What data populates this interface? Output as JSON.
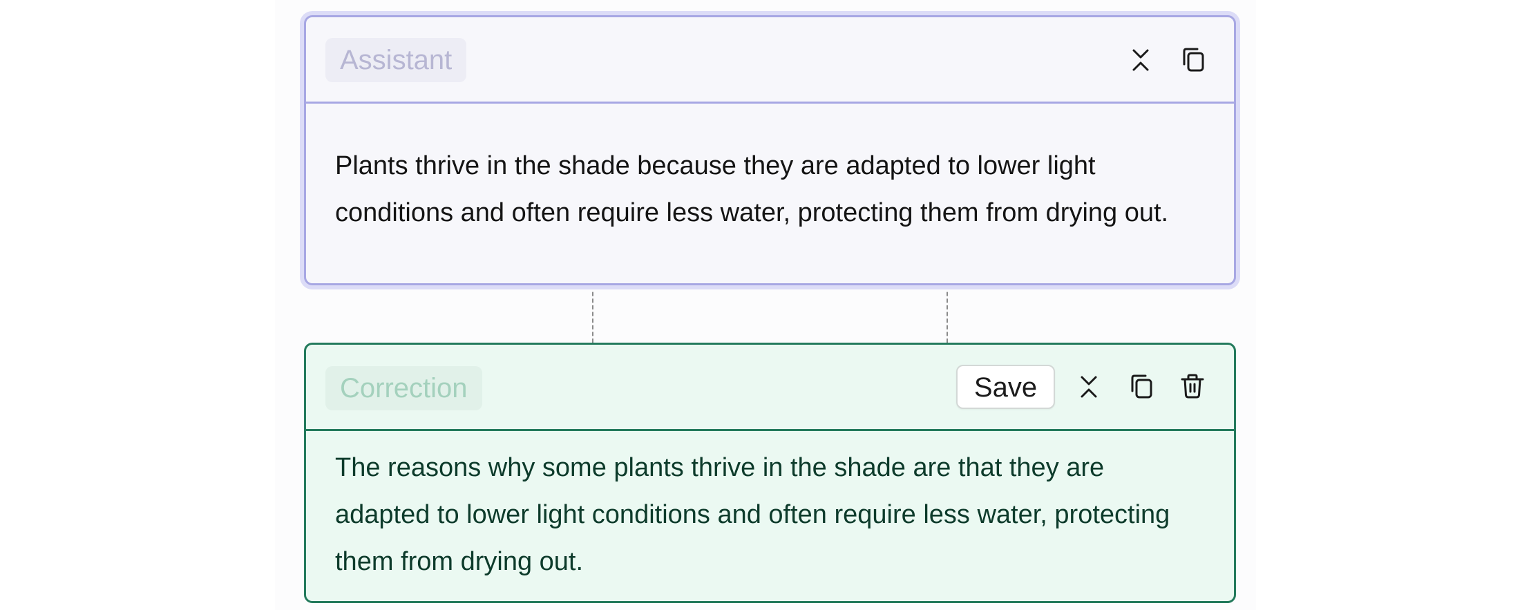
{
  "assistant": {
    "role_label": "Assistant",
    "text": "Plants thrive in the shade because they are adapted to lower light conditions and often require less water, protecting them from drying out.",
    "icons": {
      "collapse": "collapse-icon",
      "copy": "copy-icon"
    }
  },
  "correction": {
    "role_label": "Correction",
    "save_label": "Save",
    "text": "The reasons why some plants thrive in the shade are that they are adapted to lower light conditions and often require less water, protecting them from drying out.",
    "icons": {
      "collapse": "collapse-icon",
      "copy": "copy-icon",
      "delete": "trash-icon"
    }
  },
  "colors": {
    "assistant_border": "#a7a7e3",
    "assistant_background": "#f7f7fb",
    "correction_border": "#237a5c",
    "correction_background": "#ebf9f2"
  }
}
